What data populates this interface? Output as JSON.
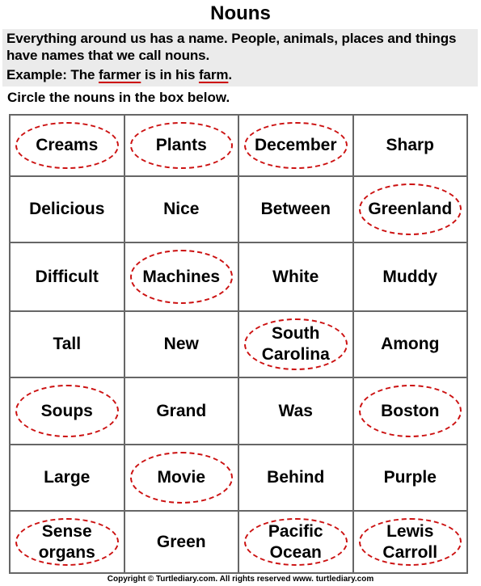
{
  "title": "Nouns",
  "intro": {
    "line1": "Everything around us has a name. People, animals, places and things",
    "line2": "have names that we call nouns.",
    "example_prefix": "Example: The ",
    "example_noun1": "farmer",
    "example_mid": " is in his ",
    "example_noun2": "farm",
    "example_suffix": "."
  },
  "instruction": "Circle the nouns in the box below.",
  "grid": {
    "rows": [
      [
        {
          "text": "Creams",
          "circled": true
        },
        {
          "text": "Plants",
          "circled": true
        },
        {
          "text": "December",
          "circled": true
        },
        {
          "text": "Sharp",
          "circled": false
        }
      ],
      [
        {
          "text": "Delicious",
          "circled": false
        },
        {
          "text": "Nice",
          "circled": false
        },
        {
          "text": "Between",
          "circled": false
        },
        {
          "text": "Greenland",
          "circled": true
        }
      ],
      [
        {
          "text": "Difficult",
          "circled": false
        },
        {
          "text": "Machines",
          "circled": true
        },
        {
          "text": "White",
          "circled": false
        },
        {
          "text": "Muddy",
          "circled": false
        }
      ],
      [
        {
          "text": "Tall",
          "circled": false
        },
        {
          "text": "New",
          "circled": false
        },
        {
          "text": "South Carolina",
          "circled": true
        },
        {
          "text": "Among",
          "circled": false
        }
      ],
      [
        {
          "text": "Soups",
          "circled": true
        },
        {
          "text": "Grand",
          "circled": false
        },
        {
          "text": "Was",
          "circled": false
        },
        {
          "text": "Boston",
          "circled": true
        }
      ],
      [
        {
          "text": "Large",
          "circled": false
        },
        {
          "text": "Movie",
          "circled": true
        },
        {
          "text": "Behind",
          "circled": false
        },
        {
          "text": "Purple",
          "circled": false
        }
      ],
      [
        {
          "text": "Sense organs",
          "circled": true
        },
        {
          "text": "Green",
          "circled": false
        },
        {
          "text": "Pacific Ocean",
          "circled": true
        },
        {
          "text": "Lewis Carroll",
          "circled": true
        }
      ]
    ]
  },
  "footer": "Copyright © Turtlediary.com. All rights reserved   www. turtlediary.com",
  "colors": {
    "circle": "#cc1111",
    "underline": "#cc0000",
    "intro_bg": "#ebebeb",
    "grid_border": "#666666"
  }
}
